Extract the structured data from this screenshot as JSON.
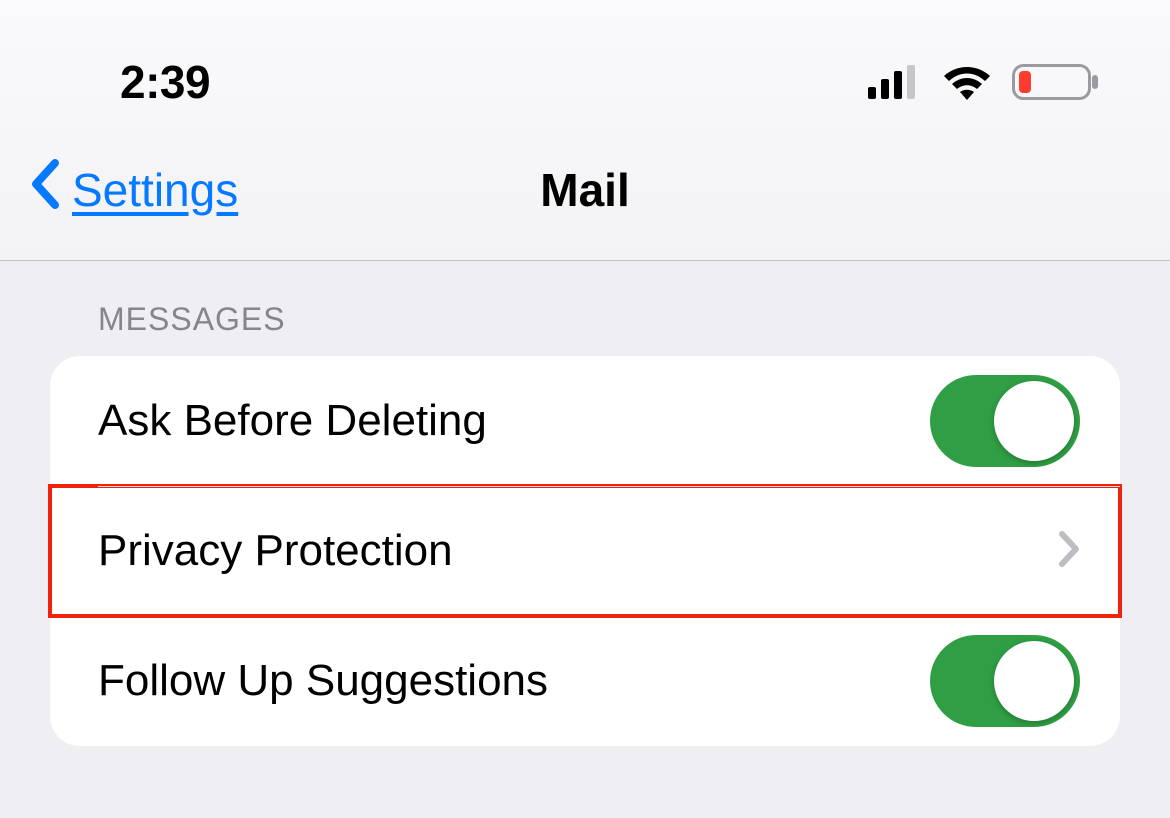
{
  "status": {
    "time": "2:39"
  },
  "nav": {
    "back_label": "Settings",
    "title": "Mail"
  },
  "section": {
    "header": "MESSAGES",
    "items": [
      {
        "label": "Ask Before Deleting",
        "type": "toggle",
        "on": true
      },
      {
        "label": "Privacy Protection",
        "type": "navigation",
        "highlighted": true
      },
      {
        "label": "Follow Up Suggestions",
        "type": "toggle",
        "on": true
      }
    ]
  }
}
